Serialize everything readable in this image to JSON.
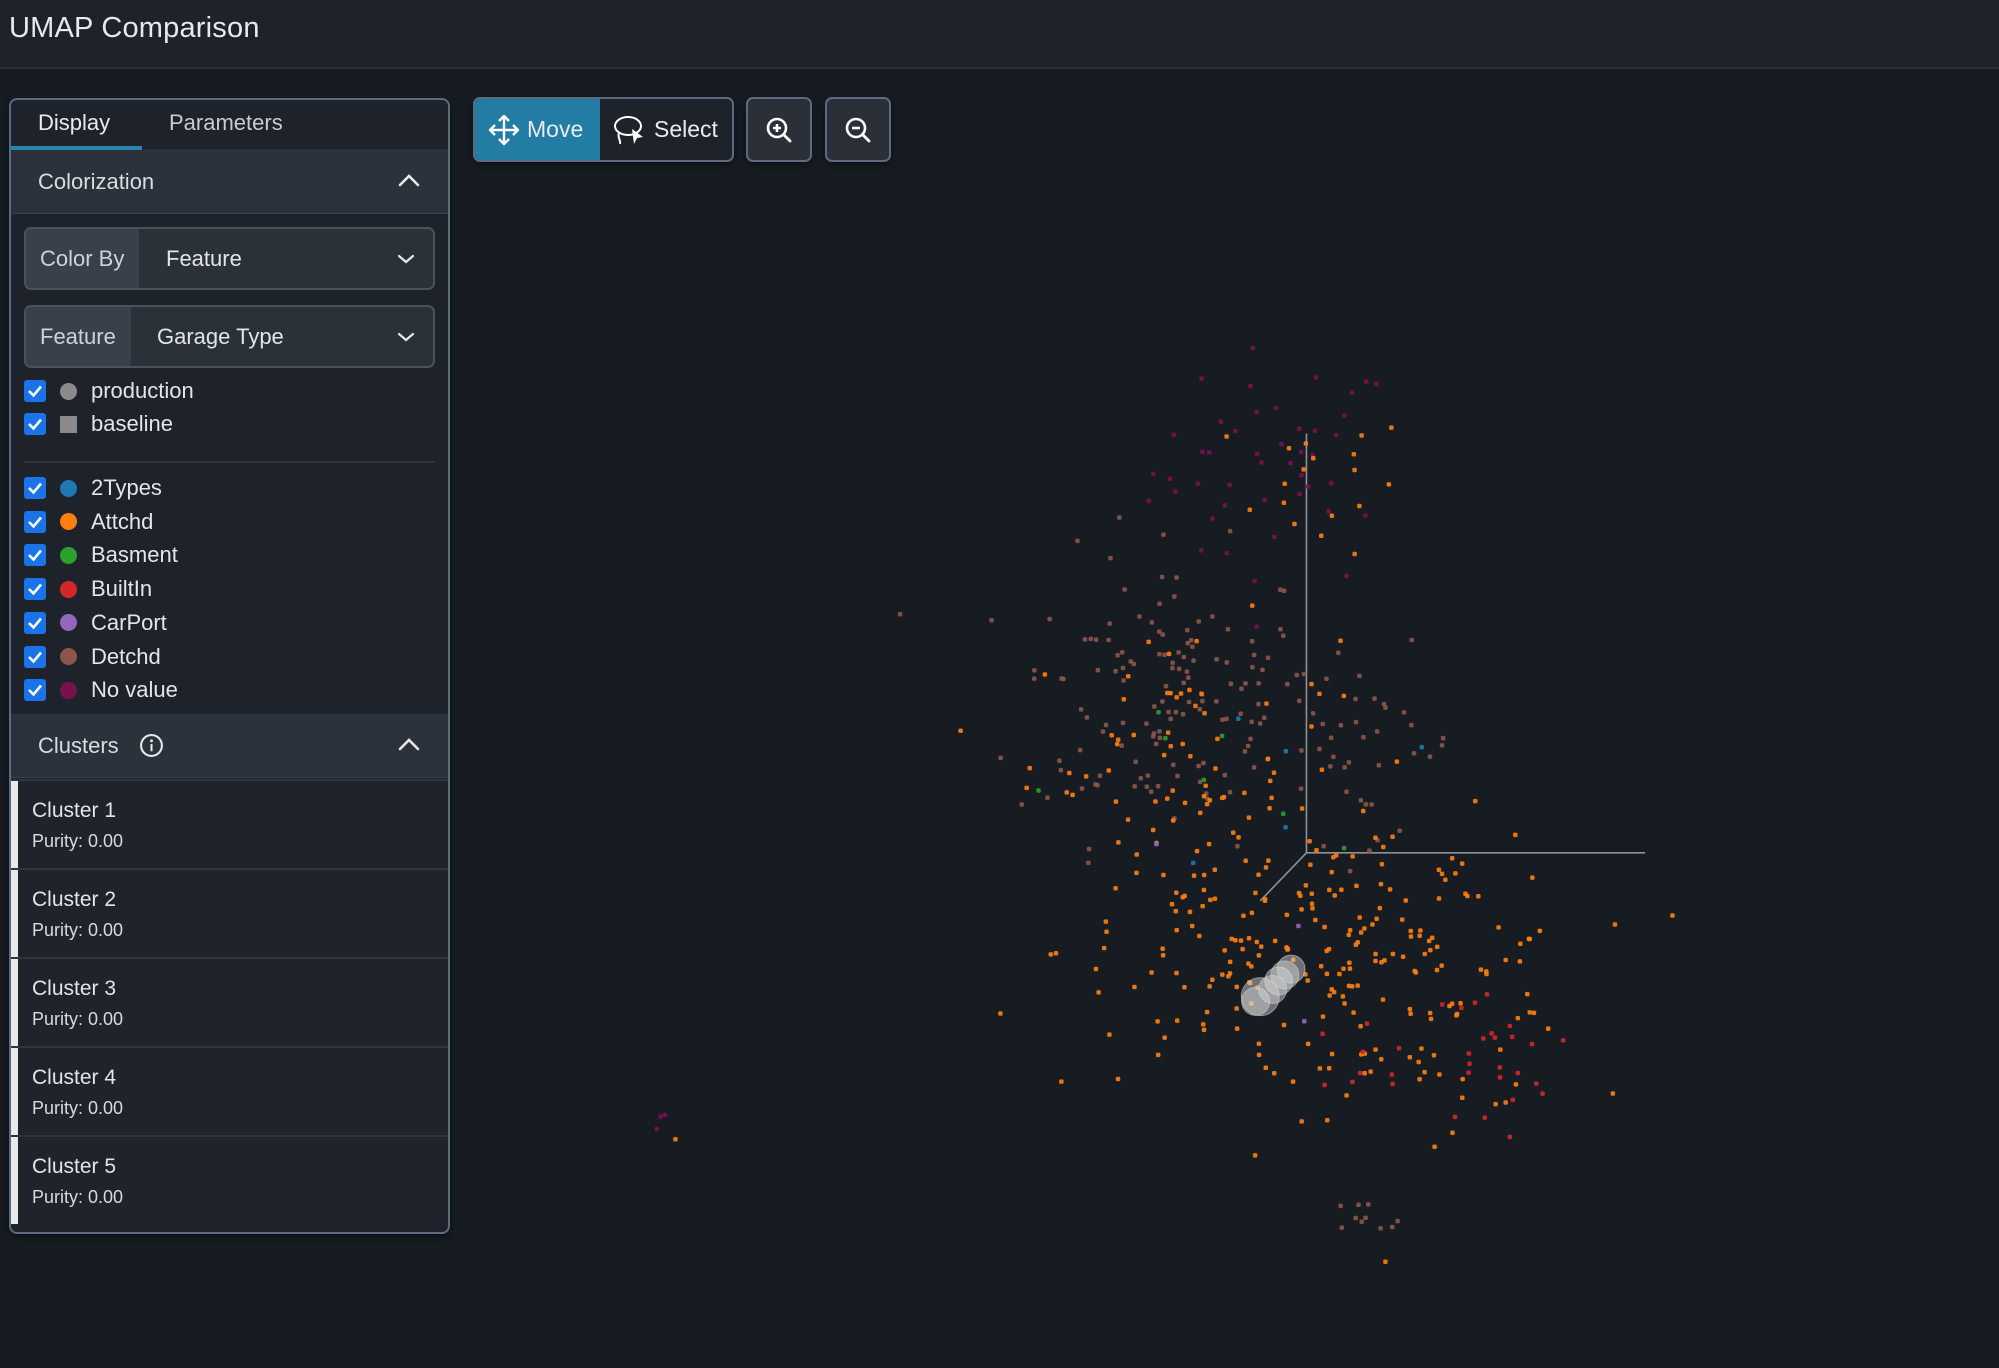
{
  "header": {
    "title": "UMAP Comparison"
  },
  "panel": {
    "tabs": [
      {
        "label": "Display",
        "active": true
      },
      {
        "label": "Parameters",
        "active": false
      }
    ],
    "colorization": {
      "title": "Colorization",
      "color_by": {
        "prefix": "Color By",
        "value": "Feature"
      },
      "feature": {
        "prefix": "Feature",
        "value": "Garage Type"
      },
      "datasets": [
        {
          "label": "production",
          "checked": true,
          "shape": "circle",
          "color": "#8a8a8a"
        },
        {
          "label": "baseline",
          "checked": true,
          "shape": "square",
          "color": "#8a8a8a"
        }
      ],
      "categories": [
        {
          "label": "2Types",
          "checked": true,
          "color": "#1f77b4"
        },
        {
          "label": "Attchd",
          "checked": true,
          "color": "#ff7f0e"
        },
        {
          "label": "Basment",
          "checked": true,
          "color": "#2ca02c"
        },
        {
          "label": "BuiltIn",
          "checked": true,
          "color": "#d62728"
        },
        {
          "label": "CarPort",
          "checked": true,
          "color": "#9467bd"
        },
        {
          "label": "Detchd",
          "checked": true,
          "color": "#8c564b"
        },
        {
          "label": "No value",
          "checked": true,
          "color": "#7b0f4f"
        }
      ]
    },
    "clusters": {
      "title": "Clusters",
      "items": [
        {
          "name": "Cluster 1",
          "purity": "Purity: 0.00"
        },
        {
          "name": "Cluster 2",
          "purity": "Purity: 0.00"
        },
        {
          "name": "Cluster 3",
          "purity": "Purity: 0.00"
        },
        {
          "name": "Cluster 4",
          "purity": "Purity: 0.00"
        },
        {
          "name": "Cluster 5",
          "purity": "Purity: 0.00"
        }
      ]
    }
  },
  "toolbar": {
    "move_label": "Move",
    "select_label": "Select",
    "active_mode": "Move",
    "zoom_in_icon": "zoom-in-icon",
    "zoom_out_icon": "zoom-out-icon"
  },
  "chart_data": {
    "type": "scatter",
    "title": "",
    "xlabel": "",
    "ylabel": "",
    "projection": "3d",
    "xlim": [
      0,
      100
    ],
    "ylim": [
      0,
      100
    ],
    "grid": false,
    "axes_3d": {
      "origin": [
        55,
        43
      ],
      "x_end": [
        77,
        43
      ],
      "y_end": [
        55,
        78
      ],
      "z_end": [
        52,
        39
      ]
    },
    "groups": [
      {
        "category": "No value",
        "color": "#7b0f4f",
        "center": [
          53,
          75
        ],
        "spread": [
          4,
          5
        ],
        "count": 45
      },
      {
        "category": "Attchd",
        "color": "#ff7f0e",
        "center": [
          56,
          74
        ],
        "spread": [
          3,
          3
        ],
        "count": 18
      },
      {
        "category": "Detchd",
        "color": "#8c564b",
        "center": [
          46,
          56
        ],
        "spread": [
          5,
          6
        ],
        "count": 140
      },
      {
        "category": "Attchd",
        "color": "#ff7f0e",
        "center": [
          47,
          52
        ],
        "spread": [
          5,
          5
        ],
        "count": 60
      },
      {
        "category": "Detchd",
        "color": "#8c564b",
        "center": [
          59,
          52
        ],
        "spread": [
          3,
          4
        ],
        "count": 35
      },
      {
        "category": "Attchd",
        "color": "#ff7f0e",
        "center": [
          51,
          35
        ],
        "spread": [
          6,
          6
        ],
        "count": 140
      },
      {
        "category": "Attchd",
        "color": "#ff7f0e",
        "center": [
          63,
          33
        ],
        "spread": [
          5,
          6
        ],
        "count": 110
      },
      {
        "category": "BuiltIn",
        "color": "#d62728",
        "center": [
          67,
          26
        ],
        "spread": [
          2,
          3
        ],
        "count": 22
      },
      {
        "category": "BuiltIn",
        "color": "#d62728",
        "center": [
          59,
          26
        ],
        "spread": [
          3,
          2
        ],
        "count": 10
      },
      {
        "category": "Detchd",
        "color": "#8c564b",
        "center": [
          58,
          12
        ],
        "spread": [
          2,
          1
        ],
        "count": 10
      },
      {
        "category": "Basment",
        "color": "#2ca02c",
        "center": [
          48,
          48
        ],
        "spread": [
          5,
          5
        ],
        "count": 7
      },
      {
        "category": "2Types",
        "color": "#1f77b4",
        "center": [
          56,
          45
        ],
        "spread": [
          4,
          8
        ],
        "count": 5
      },
      {
        "category": "CarPort",
        "color": "#9467bd",
        "center": [
          52,
          38
        ],
        "spread": [
          4,
          5
        ],
        "count": 3
      },
      {
        "category": "No value",
        "color": "#7b0f4f",
        "center": [
          13,
          20
        ],
        "spread": [
          1,
          1
        ],
        "count": 3
      },
      {
        "category": "Attchd",
        "color": "#ff7f0e",
        "center": [
          14,
          19
        ],
        "spread": [
          0.3,
          0.3
        ],
        "count": 1
      }
    ],
    "highlighted_points": {
      "label": "selected (baseline/production spheres)",
      "color": "#d9d9d9",
      "count": 6,
      "center": [
        52,
        31
      ]
    }
  }
}
